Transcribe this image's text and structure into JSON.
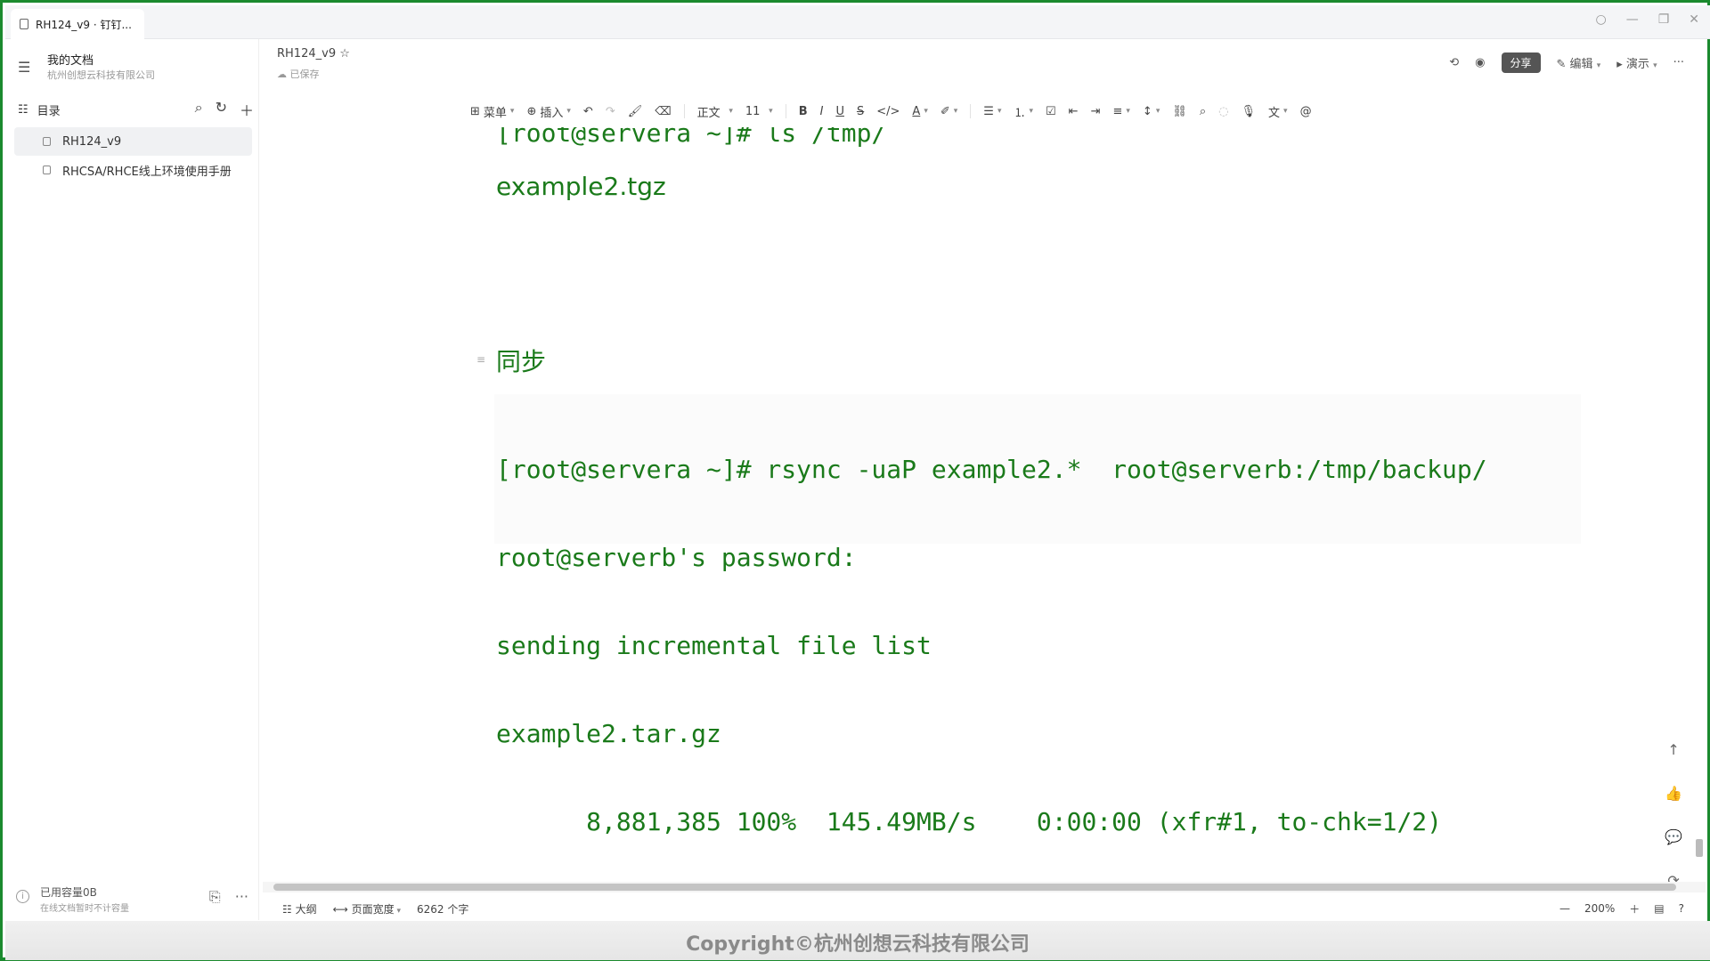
{
  "window": {
    "tab_title": "RH124_v9 · 钉钉...",
    "controls": [
      "○",
      "—",
      "❐",
      "✕"
    ]
  },
  "sidebar": {
    "workspace_name": "我的文档",
    "workspace_org": "杭州创想云科技有限公司",
    "toc_title": "目录",
    "items": [
      {
        "label": "RH124_v9",
        "active": true
      },
      {
        "label": "RHCSA/RHCE线上环境使用手册",
        "active": false
      }
    ],
    "storage_used": "已用容量0B",
    "storage_note": "在线文档暂时不计容量"
  },
  "header": {
    "doc_title": "RH124_v9",
    "saved_status": "已保存",
    "share_label": "分享",
    "edit_label": "编辑",
    "present_label": "演示",
    "more_label": "···"
  },
  "toolbar": {
    "menu_label": "菜单",
    "insert_label": "插入",
    "style_label": "正文",
    "font_size": "11",
    "bold": "B",
    "italic": "I",
    "underline": "U",
    "strike": "S",
    "code": "</>",
    "font_color": "A",
    "mention": "@"
  },
  "content": {
    "cut_line": "[root@servera ~]# ls /tmp/",
    "file_listing": "example2.tgz",
    "heading": "同步",
    "code_lines": [
      "[root@servera ~]# rsync -uaP example2.*  root@serverb:/tmp/backup/",
      "root@serverb's password:",
      "sending incremental file list",
      "example2.tar.gz",
      "      8,881,385 100%  145.49MB/s    0:00:00 (xfr#1, to-chk=1/2)"
    ]
  },
  "statusbar": {
    "outline_label": "大纲",
    "width_label": "页面宽度",
    "word_count": "6262 个字",
    "zoom": "200%"
  },
  "watermark": {
    "text": "Copyright©杭州创想云科技有限公司"
  }
}
